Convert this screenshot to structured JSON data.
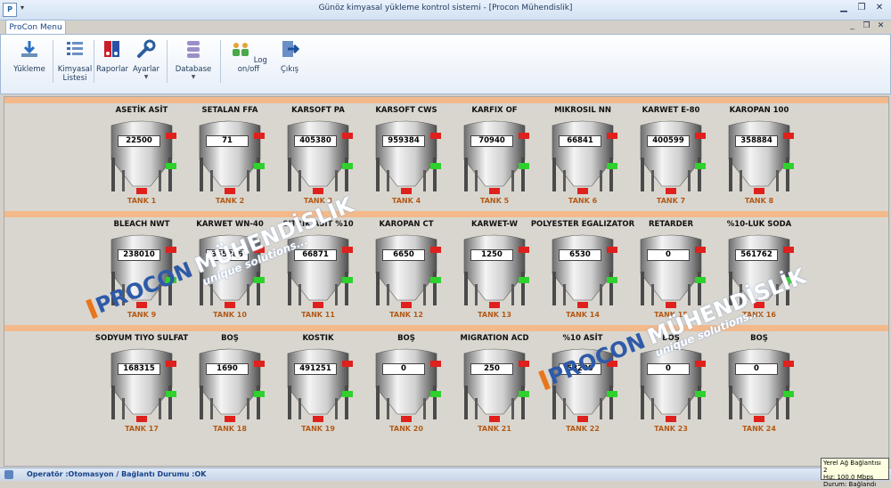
{
  "window": {
    "title": "Günöz kimyasal yükleme kontrol sistemi - [Procon Mühendislik]"
  },
  "ribbon": {
    "tab": "ProCon Menu",
    "buttons": [
      {
        "label": "Yükleme",
        "icon": "loading-icon"
      },
      {
        "label": "Kimyasal\nListesi",
        "icon": "list-icon"
      },
      {
        "label": "Raporlar",
        "icon": "reports-icon"
      },
      {
        "label": "Ayarlar",
        "icon": "wrench-icon",
        "dropdown": true
      },
      {
        "label": "Database",
        "icon": "database-icon",
        "dropdown": true
      },
      {
        "label": "Log on/off",
        "icon": "users-icon"
      },
      {
        "label": "Çıkış",
        "icon": "exit-icon"
      }
    ]
  },
  "tanks": [
    {
      "name": "ASETİK ASİT",
      "value": "22500",
      "label": "TANK 1"
    },
    {
      "name": "SETALAN FFA",
      "value": "71",
      "label": "TANK 2"
    },
    {
      "name": "KARSOFT PA",
      "value": "405380",
      "label": "TANK 3"
    },
    {
      "name": "KARSOFT CWS",
      "value": "959384",
      "label": "TANK 4"
    },
    {
      "name": "KARFIX OF",
      "value": "70940",
      "label": "TANK 5"
    },
    {
      "name": "MIKROSIL NN",
      "value": "66841",
      "label": "TANK 6"
    },
    {
      "name": "KARWET E-80",
      "value": "400599",
      "label": "TANK 7"
    },
    {
      "name": "KAROPAN 100",
      "value": "358884",
      "label": "TANK 8"
    },
    {
      "name": "BLEACH NWT",
      "value": "238010",
      "label": "TANK 9"
    },
    {
      "name": "KARWET WN-40",
      "value": "365286",
      "label": "TANK 10"
    },
    {
      "name": "SITRIK ASIT %10",
      "value": "66871",
      "label": "TANK 11"
    },
    {
      "name": "KAROPAN CT",
      "value": "6650",
      "label": "TANK 12"
    },
    {
      "name": "KARWET-W",
      "value": "1250",
      "label": "TANK 13"
    },
    {
      "name": "POLYESTER EGALIZATOR",
      "value": "6530",
      "label": "TANK 14"
    },
    {
      "name": "RETARDER",
      "value": "0",
      "label": "TANK 15"
    },
    {
      "name": "%10-LUK SODA",
      "value": "561762",
      "label": "TANK 16"
    },
    {
      "name": "SODYUM TIYO SULFAT",
      "value": "168315",
      "label": "TANK 17"
    },
    {
      "name": "BOŞ",
      "value": "1690",
      "label": "TANK 18"
    },
    {
      "name": "KOSTIK",
      "value": "491251",
      "label": "TANK 19"
    },
    {
      "name": "BOŞ",
      "value": "0",
      "label": "TANK 20"
    },
    {
      "name": "MIGRATION ACD",
      "value": "250",
      "label": "TANK 21"
    },
    {
      "name": "%10 ASİT",
      "value": "58200",
      "label": "TANK 22"
    },
    {
      "name": "BOŞ",
      "value": "0",
      "label": "TANK 23"
    },
    {
      "name": "BOŞ",
      "value": "0",
      "label": "TANK 24"
    }
  ],
  "watermark": {
    "brand1": "PROCON",
    "brand2": "MÜHENDİSLİK",
    "slogan": "unique solutions..."
  },
  "status": {
    "text": "Operatör :Otomasyon / Bağlantı Durumu :OK"
  },
  "network_tooltip": {
    "line1": "Yerel Ağ Bağlantısı 2",
    "line2": "Hız: 100.0 Mbps",
    "line3": "Durum: Bağlandı"
  },
  "colors": {
    "band": "#f3b98a",
    "tank_label": "#b35a18",
    "indicator_red": "#e0201c",
    "indicator_green": "#2fd12c"
  }
}
